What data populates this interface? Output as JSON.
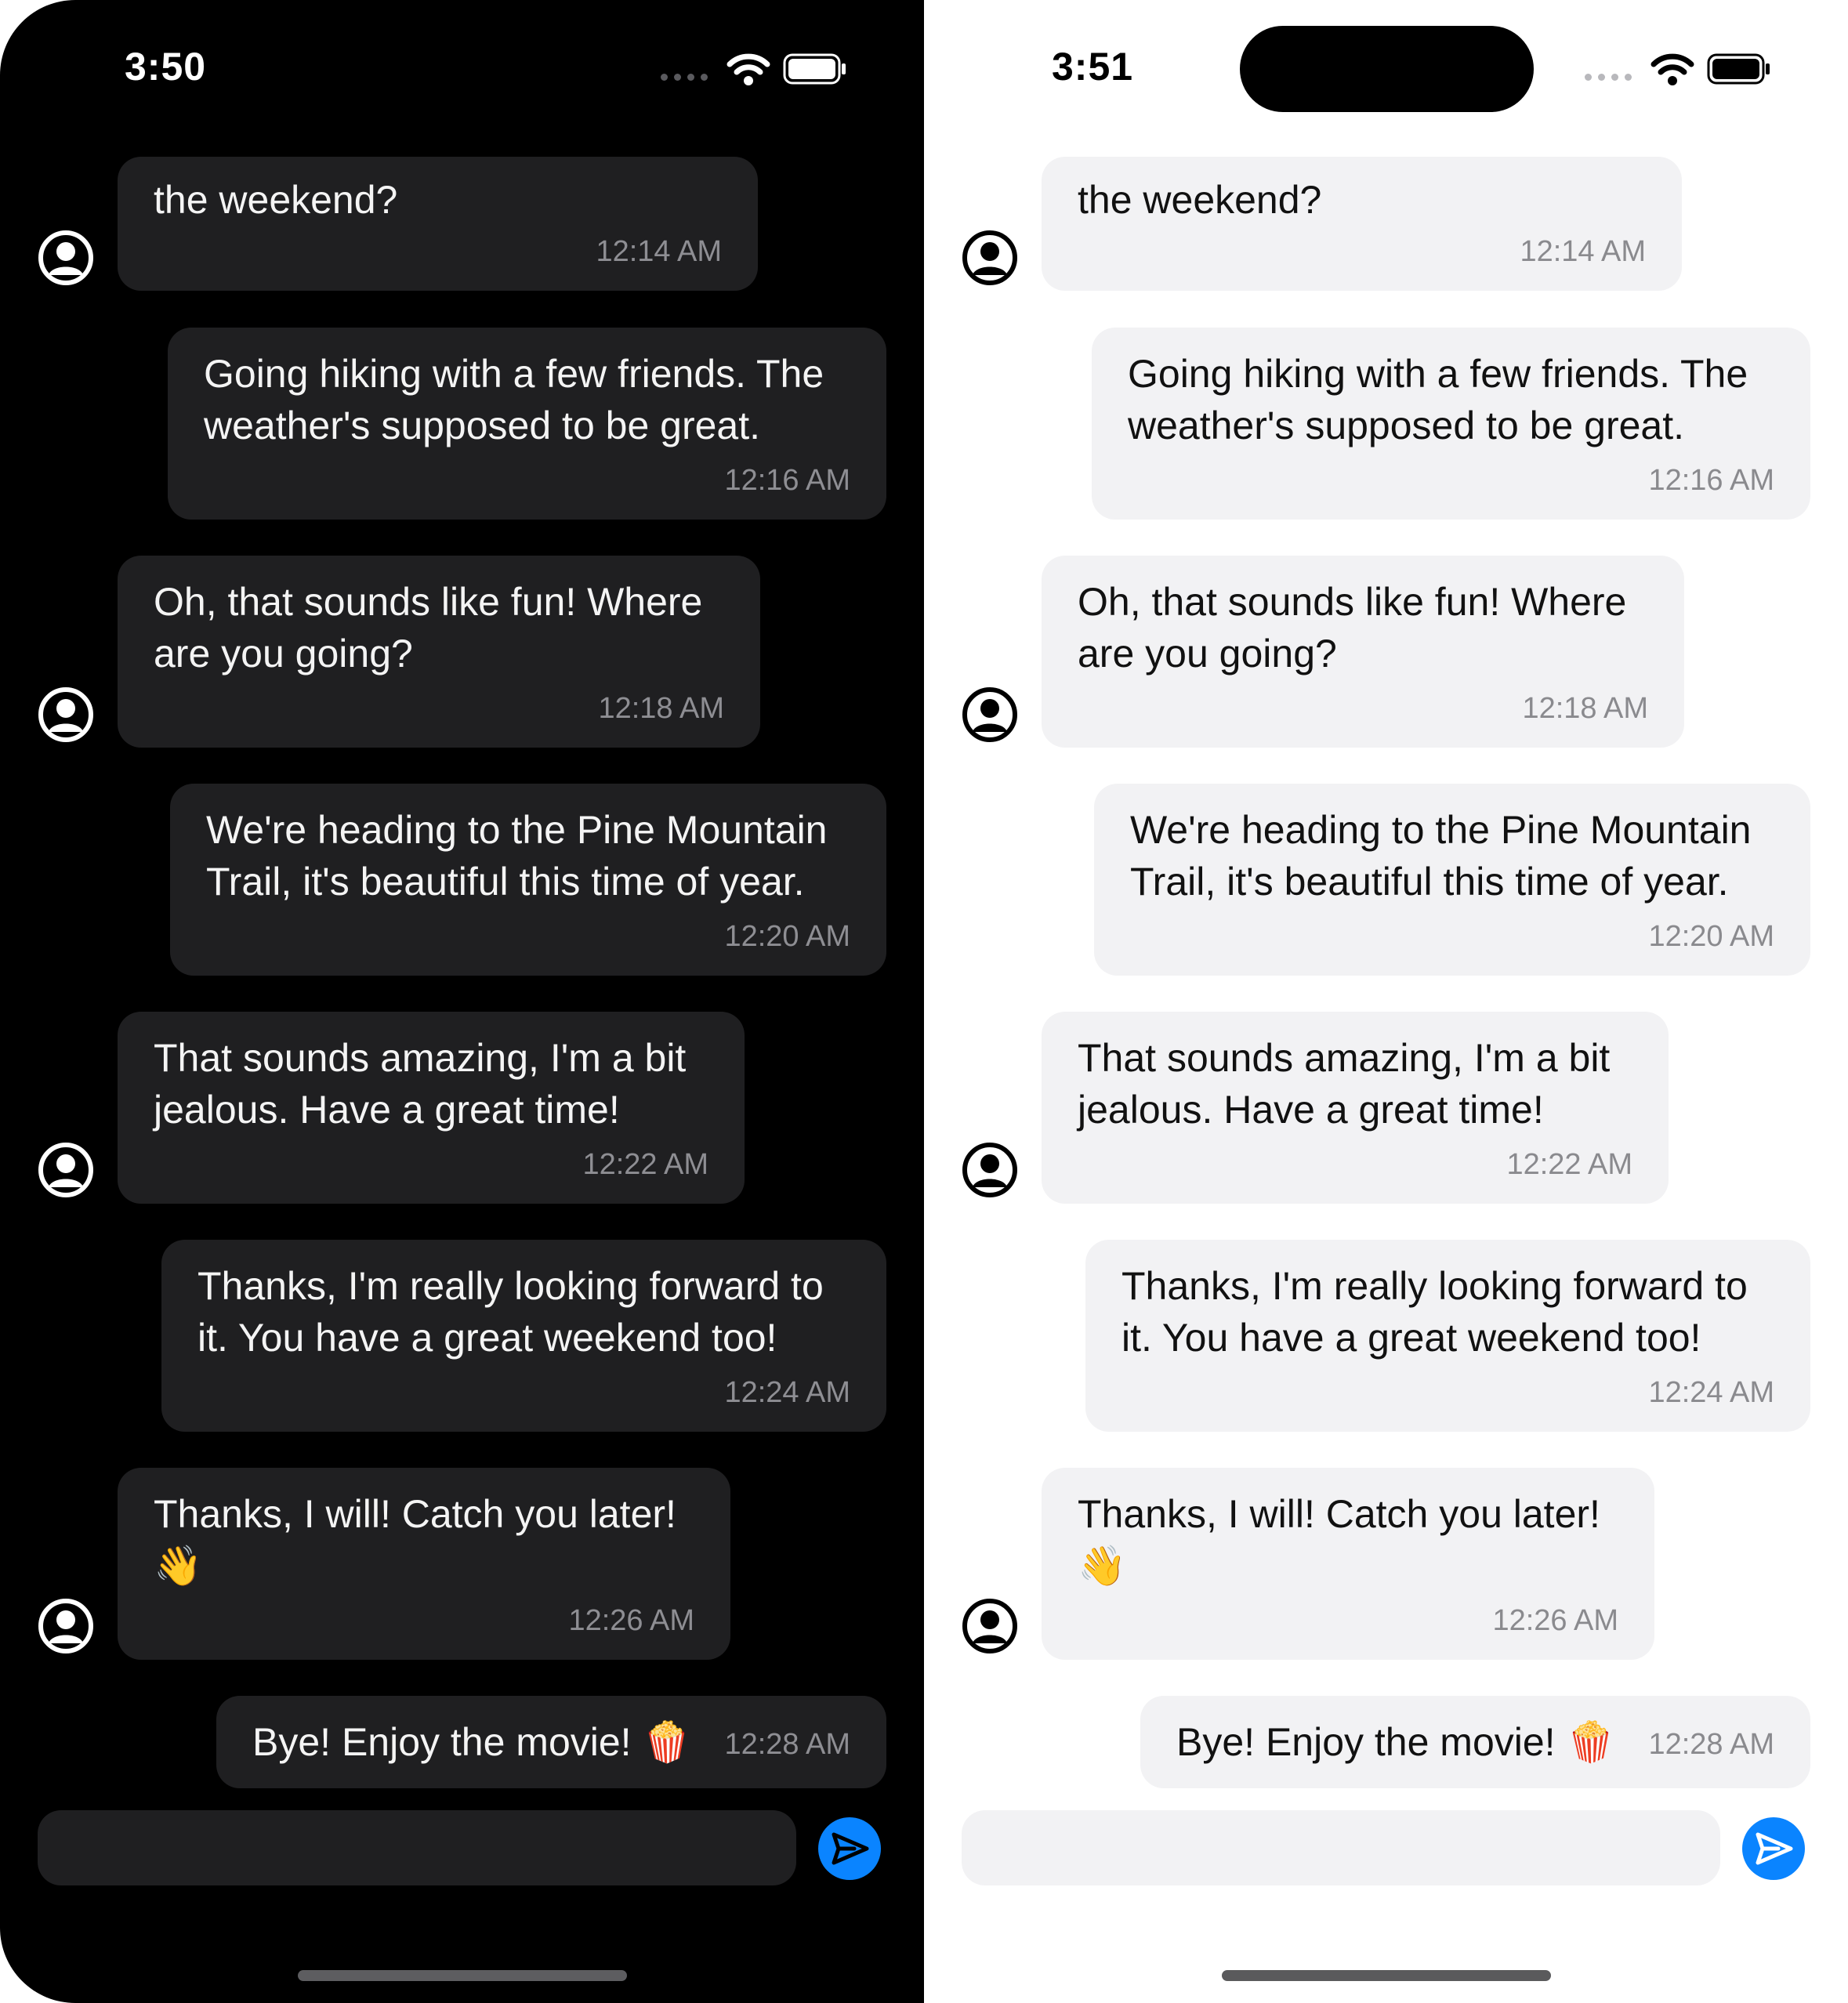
{
  "colors": {
    "dark_background": "#000000",
    "dark_bubble": "#1f1f21",
    "light_background": "#ffffff",
    "light_bubble": "#f2f2f4",
    "send_button": "#0a84ff",
    "timestamp": "#8e8e93"
  },
  "icons": {
    "avatar": "person-circle-icon",
    "send": "paperplane-icon",
    "wifi": "wifi-icon",
    "battery": "battery-icon",
    "signal": "cellular-signal-icon"
  },
  "screens": [
    {
      "theme": "dark",
      "status_bar": {
        "time": "3:50"
      },
      "input": {
        "placeholder": ""
      },
      "messages": [
        {
          "side": "incoming",
          "lines": [
            "the weekend?"
          ],
          "time": "12:14 AM"
        },
        {
          "side": "outgoing",
          "lines": [
            "Going hiking with a few friends. The",
            "weather's supposed to be great."
          ],
          "time": "12:16 AM"
        },
        {
          "side": "incoming",
          "lines": [
            "Oh, that sounds like fun! Where",
            "are you going?"
          ],
          "time": "12:18 AM"
        },
        {
          "side": "outgoing",
          "lines": [
            "We're heading to the Pine Mountain",
            "Trail, it's beautiful this time of year."
          ],
          "time": "12:20 AM"
        },
        {
          "side": "incoming",
          "lines": [
            "That sounds amazing, I'm a bit",
            "jealous. Have a great time!"
          ],
          "time": "12:22 AM"
        },
        {
          "side": "outgoing",
          "lines": [
            "Thanks, I'm really looking forward to",
            "it. You have a great weekend too!"
          ],
          "time": "12:24 AM"
        },
        {
          "side": "incoming",
          "lines": [
            "Thanks, I will! Catch you later!",
            "👋"
          ],
          "time": "12:26 AM"
        },
        {
          "side": "outgoing",
          "lines": [
            "Bye! Enjoy the movie! 🍿"
          ],
          "time": "12:28 AM"
        }
      ]
    },
    {
      "theme": "light",
      "status_bar": {
        "time": "3:51"
      },
      "input": {
        "placeholder": ""
      },
      "messages": [
        {
          "side": "incoming",
          "lines": [
            "the weekend?"
          ],
          "time": "12:14 AM"
        },
        {
          "side": "outgoing",
          "lines": [
            "Going hiking with a few friends. The",
            "weather's supposed to be great."
          ],
          "time": "12:16 AM"
        },
        {
          "side": "incoming",
          "lines": [
            "Oh, that sounds like fun! Where",
            "are you going?"
          ],
          "time": "12:18 AM"
        },
        {
          "side": "outgoing",
          "lines": [
            "We're heading to the Pine Mountain",
            "Trail, it's beautiful this time of year."
          ],
          "time": "12:20 AM"
        },
        {
          "side": "incoming",
          "lines": [
            "That sounds amazing, I'm a bit",
            "jealous. Have a great time!"
          ],
          "time": "12:22 AM"
        },
        {
          "side": "outgoing",
          "lines": [
            "Thanks, I'm really looking forward to",
            "it. You have a great weekend too!"
          ],
          "time": "12:24 AM"
        },
        {
          "side": "incoming",
          "lines": [
            "Thanks, I will! Catch you later!",
            "👋"
          ],
          "time": "12:26 AM"
        },
        {
          "side": "outgoing",
          "lines": [
            "Bye! Enjoy the movie! 🍿"
          ],
          "time": "12:28 AM"
        }
      ]
    }
  ]
}
